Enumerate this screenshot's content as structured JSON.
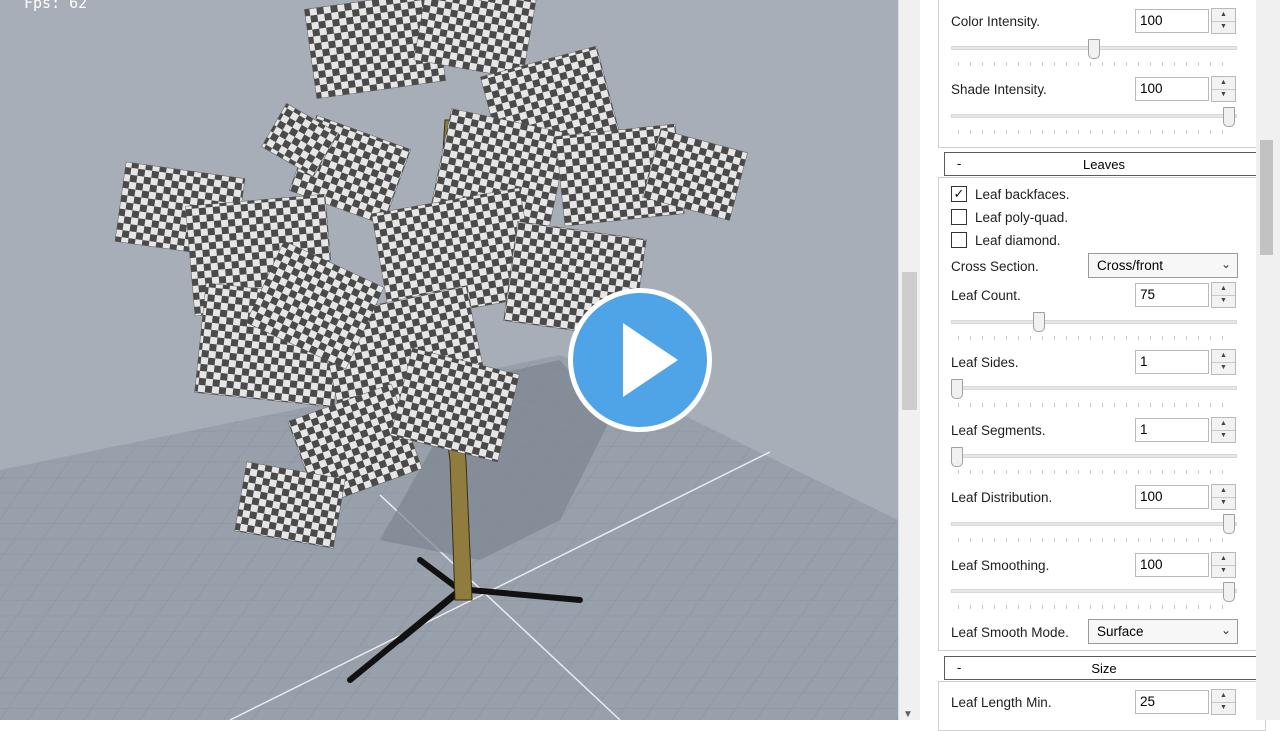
{
  "viewport": {
    "fps_text": "Fps: 62",
    "play_icon": "play-icon",
    "play_color": "#4ea4e6"
  },
  "panel": {
    "color_intensity": {
      "label": "Color Intensity.",
      "value": "100",
      "slider": 0.5
    },
    "shade_intensity": {
      "label": "Shade Intensity.",
      "value": "100",
      "slider": 1.0
    },
    "leaves": {
      "header_toggle": "-",
      "header_title": "Leaves",
      "checkboxes": [
        {
          "label": "Leaf backfaces.",
          "checked": true,
          "mark": "✓"
        },
        {
          "label": "Leaf poly-quad.",
          "checked": false,
          "mark": ""
        },
        {
          "label": "Leaf diamond.",
          "checked": false,
          "mark": ""
        }
      ],
      "cross_section": {
        "label": "Cross Section.",
        "value": "Cross/front"
      },
      "leaf_count": {
        "label": "Leaf Count.",
        "value": "75",
        "slider": 0.3
      },
      "leaf_sides": {
        "label": "Leaf Sides.",
        "value": "1",
        "slider": 0.0
      },
      "leaf_segments": {
        "label": "Leaf Segments.",
        "value": "1",
        "slider": 0.0
      },
      "leaf_distribution": {
        "label": "Leaf Distribution.",
        "value": "100",
        "slider": 1.0
      },
      "leaf_smoothing": {
        "label": "Leaf Smoothing.",
        "value": "100",
        "slider": 1.0
      },
      "leaf_smooth_mode": {
        "label": "Leaf Smooth Mode.",
        "value": "Surface"
      }
    },
    "size": {
      "header_toggle": "-",
      "header_title": "Size",
      "leaf_length_min": {
        "label": "Leaf Length Min.",
        "value": "25"
      }
    }
  }
}
